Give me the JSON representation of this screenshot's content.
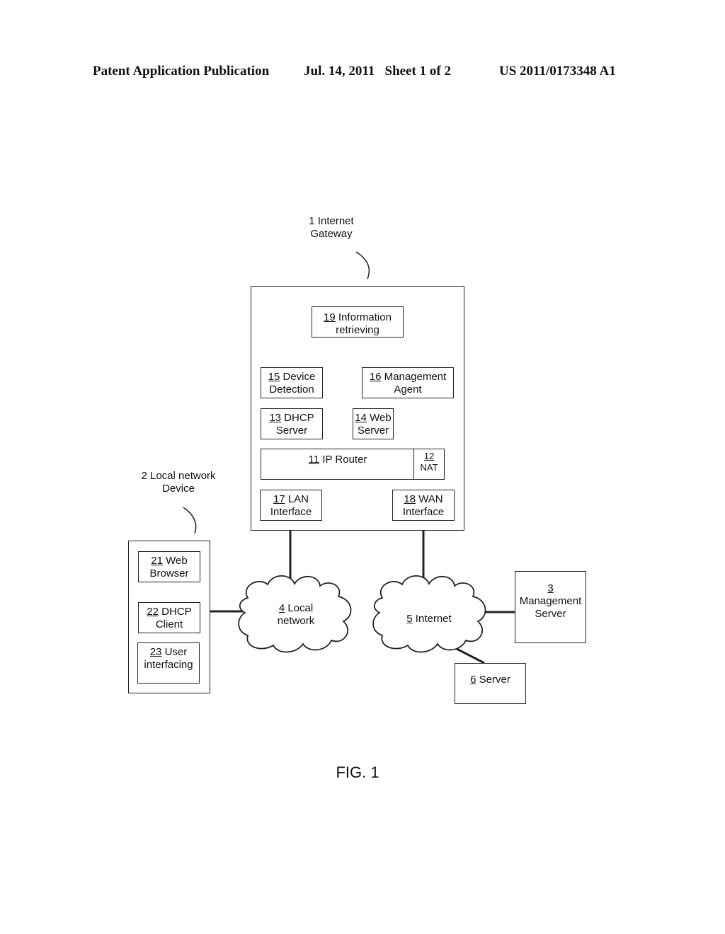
{
  "header": {
    "publication": "Patent Application Publication",
    "date_sheet": "Jul. 14, 2011   Sheet 1 of 2",
    "number": "US 2011/0173348 A1"
  },
  "diagram": {
    "gateway": {
      "line1": "1 Internet",
      "line2": "Gateway"
    },
    "local_device": {
      "line1": "2 Local network",
      "line2": "Device"
    },
    "components": {
      "info_retrieving": {
        "num": "19",
        "line1": " Information",
        "line2": "retrieving"
      },
      "device_detection": {
        "num": "15",
        "line1": " Device",
        "line2": "Detection"
      },
      "management_agent": {
        "num": "16",
        "line1": " Management",
        "line2": "Agent"
      },
      "dhcp_server": {
        "num": "13",
        "line1": " DHCP",
        "line2": "Server"
      },
      "web_server": {
        "num": "14",
        "line1": " Web",
        "line2": "Server"
      },
      "ip_router": {
        "num": "11",
        "line1": " IP Router"
      },
      "nat": {
        "num": "12",
        "line2": "NAT"
      },
      "lan_interface": {
        "num": "17",
        "line1": " LAN",
        "line2": "Interface"
      },
      "wan_interface": {
        "num": "18",
        "line1": " WAN",
        "line2": "Interface"
      },
      "web_browser": {
        "num": "21",
        "line1": " Web",
        "line2": "Browser"
      },
      "dhcp_client": {
        "num": "22",
        "line1": " DHCP",
        "line2": "Client"
      },
      "user_interfacing": {
        "num": "23",
        "line1": " User",
        "line2": "interfacing"
      },
      "local_network": {
        "num": "4",
        "line1": " Local",
        "line2": "network"
      },
      "internet": {
        "num": "5",
        "line1": " Internet"
      },
      "management_server": {
        "num": "3",
        "line1": "Management",
        "line2": "Server"
      },
      "server": {
        "num": "6",
        "line1": " Server"
      }
    },
    "figure_label": "FIG. 1"
  }
}
